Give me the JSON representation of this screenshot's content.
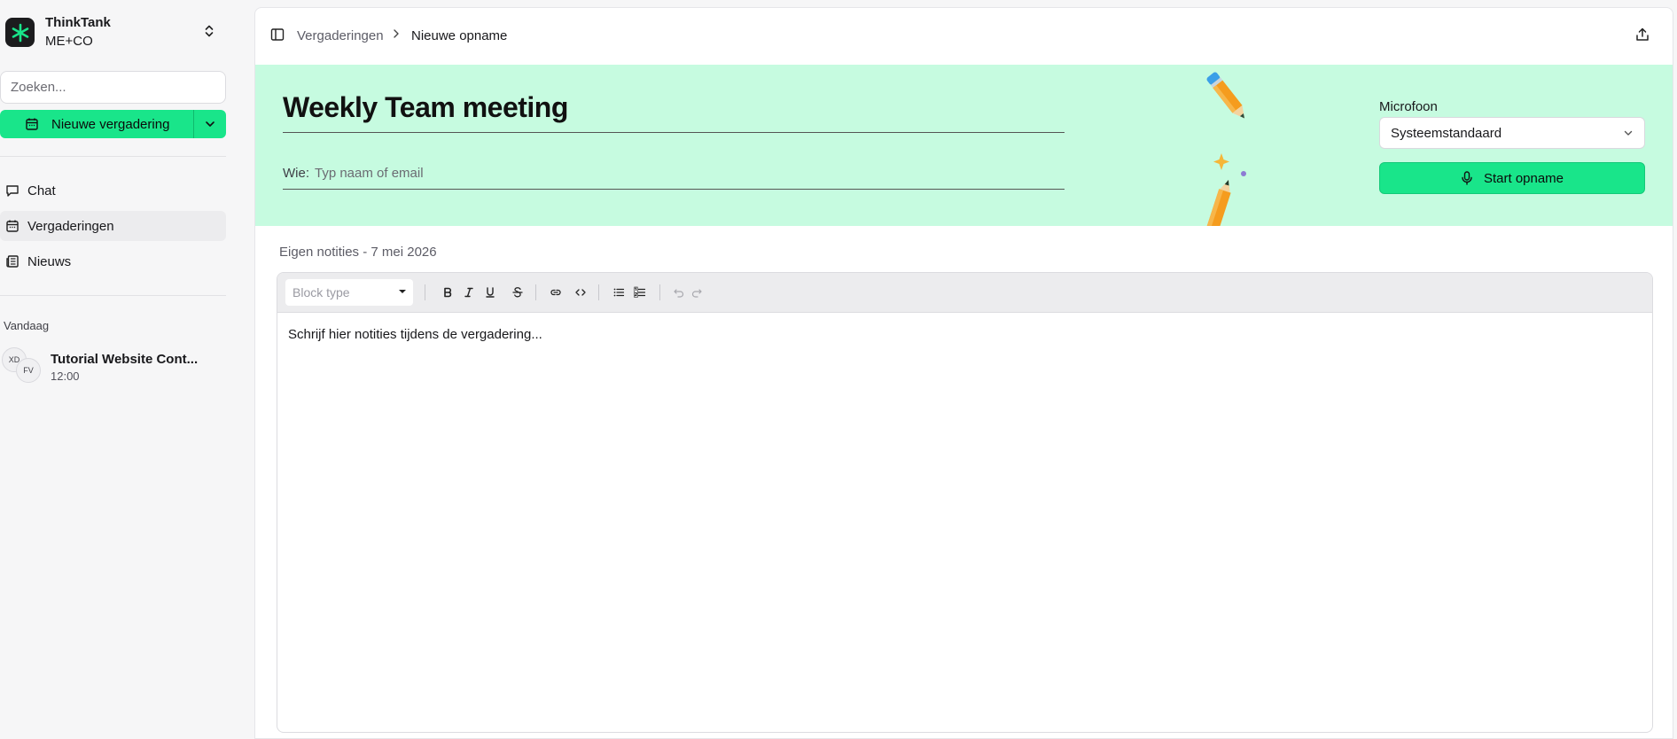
{
  "workspace": {
    "name": "ThinkTank",
    "org": "ME+CO"
  },
  "search": {
    "placeholder": "Zoeken..."
  },
  "new_meeting": {
    "label": "Nieuwe vergadering"
  },
  "nav": [
    {
      "label": "Chat",
      "icon": "chat-bubble-icon"
    },
    {
      "label": "Vergaderingen",
      "icon": "calendar-icon",
      "active": true
    },
    {
      "label": "Nieuws",
      "icon": "newspaper-icon"
    }
  ],
  "recent": {
    "section": "Vandaag",
    "items": [
      {
        "title": "Tutorial Website Cont...",
        "time": "12:00",
        "avatars": [
          "XD",
          "FV"
        ]
      }
    ]
  },
  "breadcrumb": {
    "parent": "Vergaderingen",
    "current": "Nieuwe opname"
  },
  "meeting": {
    "title": "Weekly Team meeting",
    "who_label": "Wie:",
    "who_placeholder": "Typ naam of email"
  },
  "microphone": {
    "label": "Microfoon",
    "selected": "Systeemstandaard"
  },
  "start_button": {
    "label": "Start opname"
  },
  "notes": {
    "header": "Eigen notities - 7 mei 2026",
    "block_type_placeholder": "Block type",
    "body_placeholder": "Schrijf hier notities tijdens de vergadering..."
  },
  "colors": {
    "accent": "#19e58a",
    "hero_bg": "#c6fbe0",
    "sidebar_bg": "#f6f6f7"
  }
}
